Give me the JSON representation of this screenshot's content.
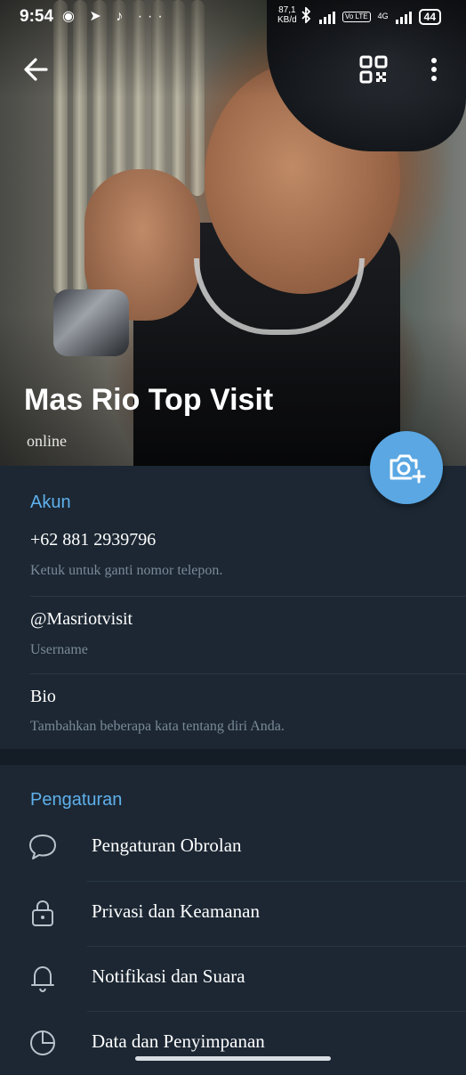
{
  "status_bar": {
    "time": "9:54",
    "left_icons": "◉ ➤ ♪ ···",
    "net_speed_value": "87,1",
    "net_speed_unit": "KB/d",
    "volte": "Vo LTE",
    "network": "4G",
    "battery": "44"
  },
  "header": {
    "name": "Mas Rio Top Visit",
    "status": "online",
    "icons": {
      "back": "back-arrow-icon",
      "qr": "qr-code-icon",
      "menu": "more-vertical-icon",
      "camera": "add-photo-icon"
    }
  },
  "account": {
    "title": "Akun",
    "phone": "+62 881 2939796",
    "phone_hint": "Ketuk untuk ganti nomor telepon.",
    "username": "@Masriotvisit",
    "username_label": "Username",
    "bio_label": "Bio",
    "bio_hint": "Tambahkan beberapa kata tentang diri Anda."
  },
  "settings": {
    "title": "Pengaturan",
    "items": [
      {
        "label": "Pengaturan Obrolan",
        "icon": "chat-bubble-icon"
      },
      {
        "label": "Privasi dan Keamanan",
        "icon": "lock-icon"
      },
      {
        "label": "Notifikasi dan Suara",
        "icon": "bell-icon"
      },
      {
        "label": "Data dan Penyimpanan",
        "icon": "pie-chart-icon"
      }
    ]
  },
  "colors": {
    "accent": "#5fb0ec",
    "background": "#1c2733",
    "fab": "#5aa7e3"
  }
}
